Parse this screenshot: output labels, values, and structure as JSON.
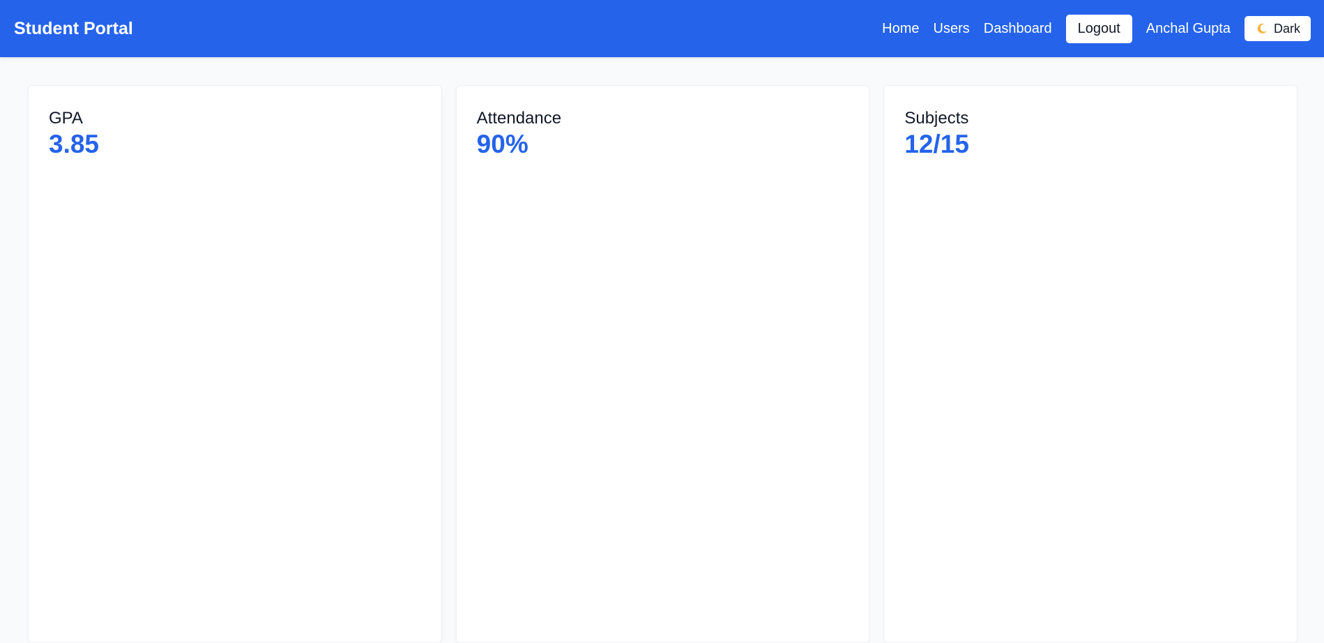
{
  "colors": {
    "primary": "#2563eb",
    "white": "#ffffff",
    "text": "#111827"
  },
  "navbar": {
    "brand": "Student Portal",
    "links": [
      "Home",
      "Users",
      "Dashboard"
    ],
    "logout_label": "Logout",
    "user_name": "Anchal Gupta",
    "theme_label": "Dark",
    "theme_icon": "moon-icon"
  },
  "cards": [
    {
      "title": "GPA",
      "value": "3.85"
    },
    {
      "title": "Attendance",
      "value": "90%"
    },
    {
      "title": "Subjects",
      "value": "12/15"
    }
  ]
}
